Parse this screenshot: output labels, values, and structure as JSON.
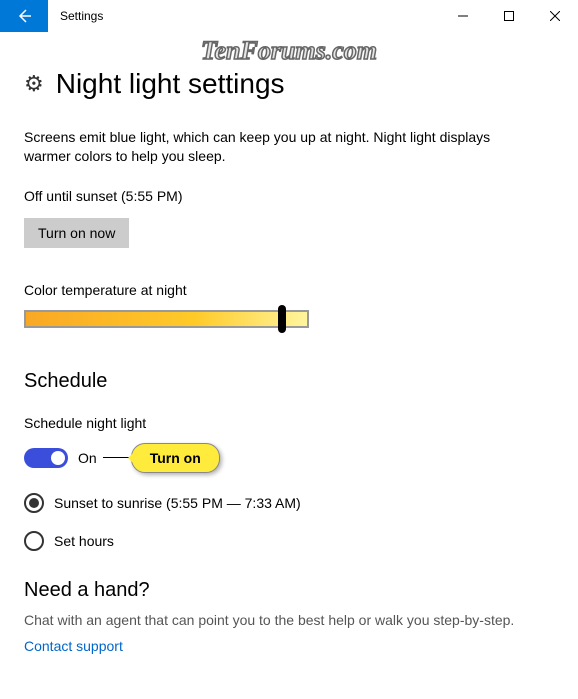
{
  "window": {
    "app_title": "Settings"
  },
  "watermark": "TenForums.com",
  "page": {
    "title": "Night light settings",
    "description": "Screens emit blue light, which can keep you up at night. Night light displays warmer colors to help you sleep.",
    "status": "Off until sunset (5:55 PM)",
    "turn_on_button": "Turn on now",
    "color_temp_label": "Color temperature at night"
  },
  "schedule": {
    "heading": "Schedule",
    "toggle_label": "Schedule night light",
    "toggle_state": "On",
    "callout": "Turn on",
    "radio_options": [
      {
        "label": "Sunset to sunrise (5:55 PM — 7:33 AM)",
        "selected": true
      },
      {
        "label": "Set hours",
        "selected": false
      }
    ]
  },
  "help": {
    "heading": "Need a hand?",
    "text": "Chat with an agent that can point you to the best help or walk you step-by-step.",
    "link": "Contact support"
  }
}
